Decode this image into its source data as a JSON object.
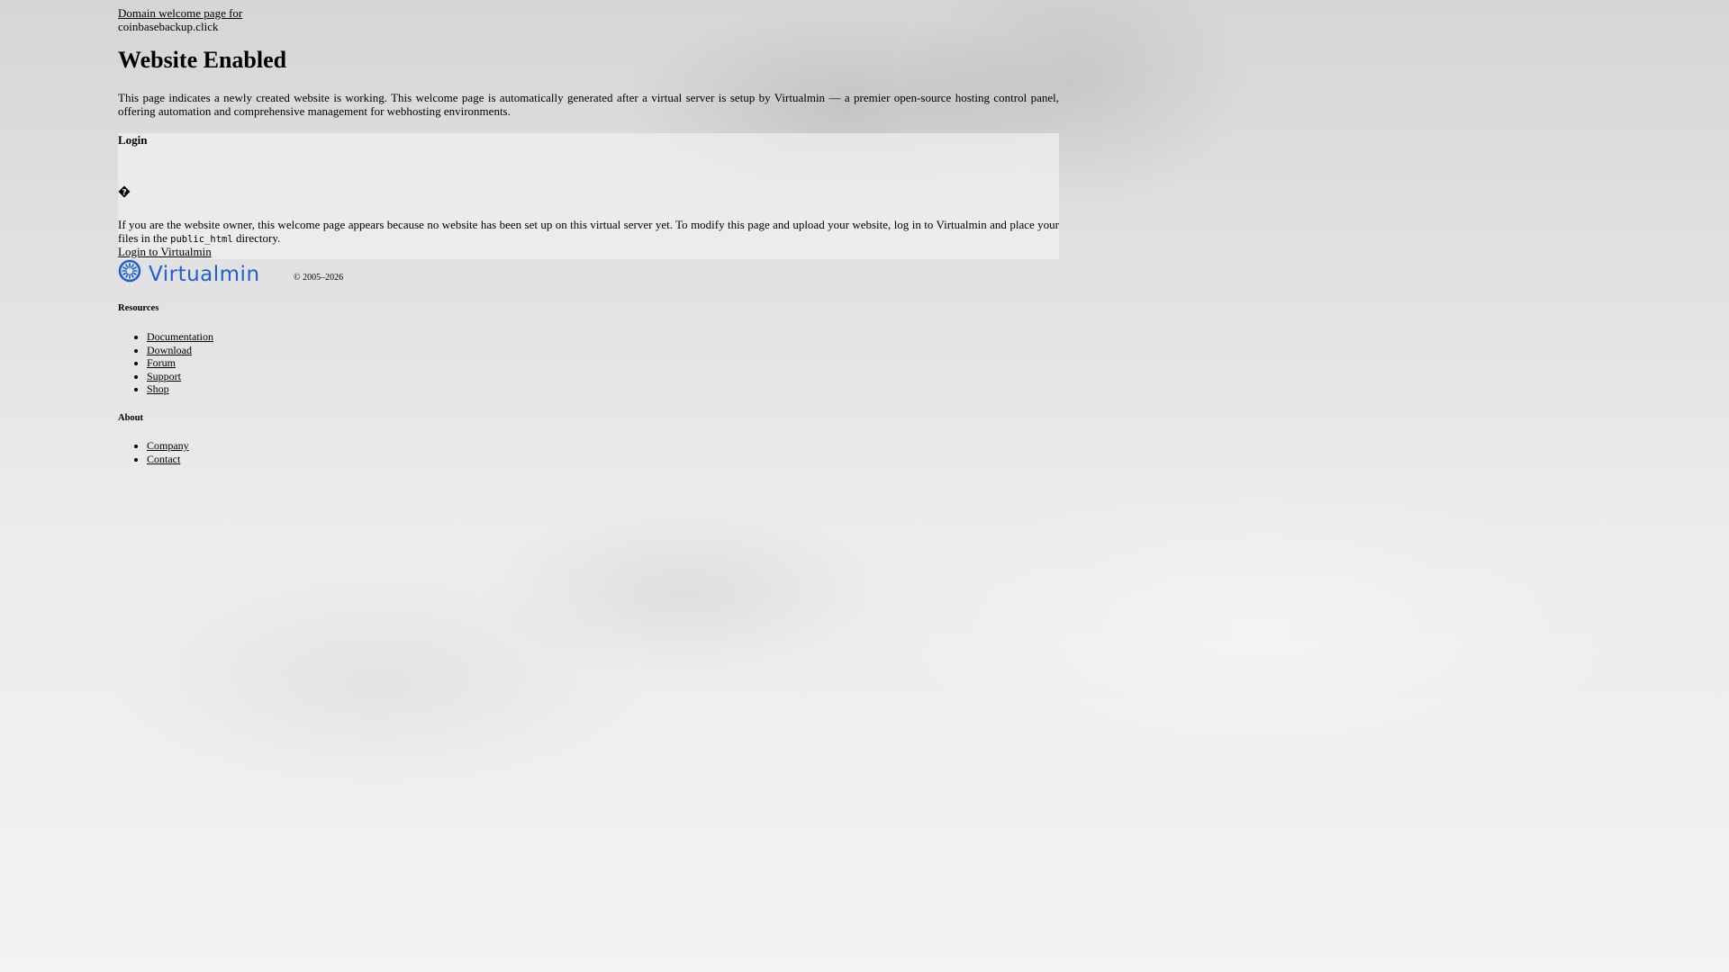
{
  "header": {
    "welcome_link": "Domain welcome page for",
    "domain": "coinbasebackup.click"
  },
  "main": {
    "title": "Website Enabled",
    "intro": "This page indicates a newly created website is working. This welcome page is automatically generated after a virtual server is setup by Virtualmin — a premier open-source hosting control panel, offering automation and comprehensive management for webhosting environments."
  },
  "login": {
    "heading": "Login",
    "owner_text_before": "If you are the website owner, this welcome page appears because no website has been set up on this virtual server yet. To modify this page and upload your website, log in to Virtualmin and place your files in the",
    "owner_code": "public_html",
    "owner_text_after": "directory.",
    "link_label": "Login to Virtualmin"
  },
  "footer": {
    "logo_text": "Virtualmin",
    "copyright": "© 2005–2026",
    "resources_heading": "Resources",
    "resources": [
      "Documentation",
      "Download",
      "Forum",
      "Support",
      "Shop"
    ],
    "about_heading": "About",
    "about": [
      "Company",
      "Contact"
    ]
  },
  "colors": {
    "logo_blue": "#1f5fd6",
    "text": "#000000"
  },
  "icons": {
    "login_icon": "diamond-icon",
    "logo_icon": "virtualmin-swirl-icon"
  }
}
